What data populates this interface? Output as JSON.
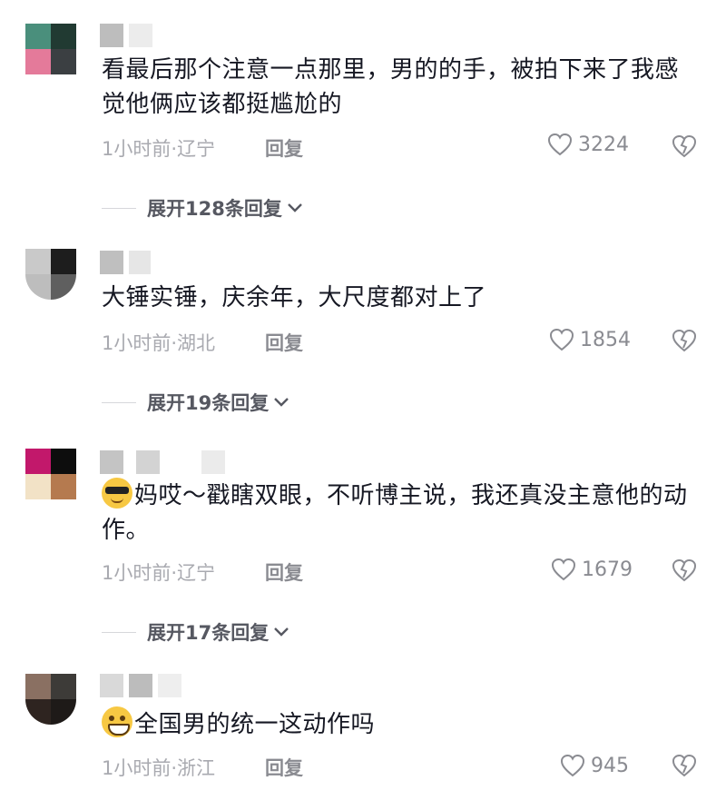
{
  "comments": [
    {
      "text": "看最后那个注意一点那里，男的的手，被拍下来了我感觉他俩应该都挺尴尬的",
      "meta": "1小时前·辽宁",
      "reply_label": "回复",
      "likes": "3224",
      "expand_label": "展开128条回复",
      "avatar_colors": [
        "#4a8f7c",
        "#213a32",
        "#e47a9a",
        "#3b3f42"
      ],
      "emoji": null
    },
    {
      "text": "大锤实锤，庆余年，大尺度都对上了",
      "meta": "1小时前·湖北",
      "reply_label": "回复",
      "likes": "1854",
      "expand_label": "展开19条回复",
      "avatar_colors": [
        "#c9c9c9",
        "#1d1d1d",
        "#bdbdbd",
        "#5f5f5f"
      ],
      "emoji": null
    },
    {
      "text": "妈哎～戳瞎双眼，不听博主说，我还真没主意他的动作。",
      "meta": "1小时前·辽宁",
      "reply_label": "回复",
      "likes": "1679",
      "expand_label": "展开17条回复",
      "avatar_colors": [
        "#c2186b",
        "#0d0d0d",
        "#f2e2c6",
        "#b57a4f"
      ],
      "emoji": "sunglasses-emoji"
    },
    {
      "text": "全国男的统一这动作吗",
      "meta": "1小时前·浙江",
      "reply_label": "回复",
      "likes": "945",
      "expand_label": null,
      "avatar_colors": [
        "#8a7062",
        "#3d3b38",
        "#2e2420",
        "#1e1a18"
      ],
      "emoji": "grin-sweat-emoji"
    }
  ],
  "icons": {
    "like": "heart-outline-icon",
    "dislike": "broken-heart-icon",
    "expand": "chevron-down-icon"
  }
}
